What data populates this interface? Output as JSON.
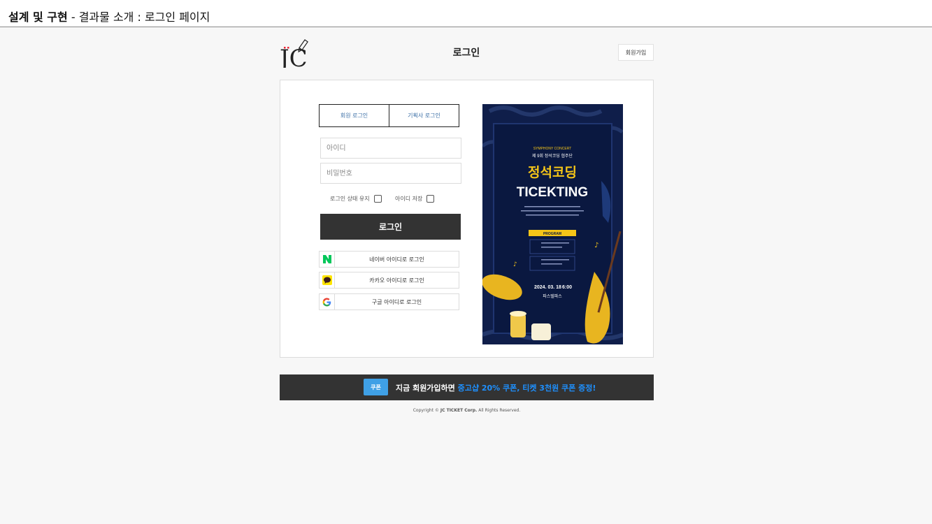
{
  "header": {
    "title_bold": "설계 및 구현",
    "title_rest": " - 결과물 소개 : 로그인 페이지"
  },
  "site": {
    "logo_text": "JC",
    "page_title": "로그인",
    "signup_label": "회원가입"
  },
  "login": {
    "tabs": [
      {
        "label": "회원 로그인"
      },
      {
        "label": "기획사 로그인"
      }
    ],
    "id_placeholder": "아이디",
    "pw_placeholder": "비밀번호",
    "keep_login_label": "로그인 상태 유지",
    "save_id_label": "아이디 저장",
    "submit_label": "로그인",
    "social": [
      {
        "label": "네이버 아이디로 로그인",
        "icon": "naver-icon"
      },
      {
        "label": "카카오 아이디로 로그인",
        "icon": "kakao-icon"
      },
      {
        "label": "구글 아이디로 로그인",
        "icon": "google-icon"
      }
    ]
  },
  "poster": {
    "subtitle": "SYMPHONY CONCERT",
    "edition": "제 9회 정석코딩 협주단",
    "title_ko": "정석코딩",
    "title_en": "TICEKTING",
    "program_label": "PROGRAM",
    "date": "2024. 03. 18",
    "time_suffix": "6:00",
    "venue": "파스텔파스"
  },
  "banner": {
    "badge": "쿠폰",
    "text_white": "지금 회원가입하면 ",
    "text_highlight": "중고샵 20% 쿠폰, 티켓 3천원 쿠폰 증정!"
  },
  "footer": {
    "prefix": "Copyright © ",
    "company": "JC TICKET Corp.",
    "suffix": " All Rights Reserved."
  },
  "colors": {
    "dark": "#333333",
    "accent_blue": "#1e90ff",
    "poster_navy": "#0f1e4a",
    "poster_yellow": "#f5c518"
  }
}
